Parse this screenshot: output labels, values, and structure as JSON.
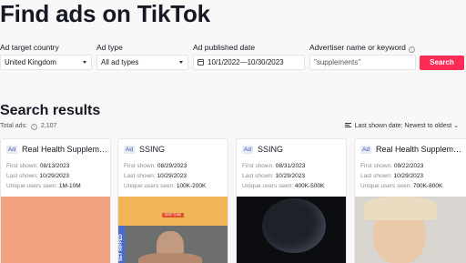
{
  "page": {
    "title": "Find ads on TikTok"
  },
  "filters": {
    "country": {
      "label": "Ad target country",
      "value": "United Kingdom",
      "icon": "chevron-down-icon"
    },
    "ad_type": {
      "label": "Ad type",
      "value": "All ad types",
      "icon": "chevron-down-icon"
    },
    "published": {
      "label": "Ad published date",
      "value": "10/1/2022—10/30/2023",
      "icon": "calendar-icon"
    },
    "advertiser": {
      "label": "Advertiser name or keyword",
      "value": "\"supplements\"",
      "icon": "info-icon"
    },
    "search_label": "Search",
    "accent_color": "#fe2c55"
  },
  "results": {
    "title": "Search results",
    "total_label": "Total ads:",
    "total_value": "2,107",
    "sort_label": "Last shown date: Newest to oldest",
    "sort_caret": "⌄",
    "cards": [
      {
        "badge": "Ad",
        "name": "Real Health Supplem…",
        "first_label": "First shown:",
        "first_value": "08/13/2023",
        "last_label": "Last shown:",
        "last_value": "10/29/2023",
        "users_label": "Unique users seen:",
        "users_value": "1M-10M"
      },
      {
        "badge": "Ad",
        "name": "SSING",
        "first_label": "First shown:",
        "first_value": "08/29/2023",
        "last_label": "Last shown:",
        "last_value": "10/29/2023",
        "users_label": "Unique users seen:",
        "users_value": "100K-200K",
        "thumb_text": "SET RIPPED",
        "thumb_tag": "GRIP TUBE"
      },
      {
        "badge": "Ad",
        "name": "SSING",
        "first_label": "First shown:",
        "first_value": "08/31/2023",
        "last_label": "Last shown:",
        "last_value": "10/29/2023",
        "users_label": "Unique users seen:",
        "users_value": "400K-500K"
      },
      {
        "badge": "Ad",
        "name": "Real Health Supplem…",
        "first_label": "First shown:",
        "first_value": "09/22/2023",
        "last_label": "Last shown:",
        "last_value": "10/29/2023",
        "users_label": "Unique users seen:",
        "users_value": "700K-800K"
      }
    ]
  }
}
